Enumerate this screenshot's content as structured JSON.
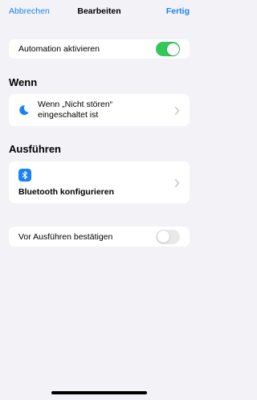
{
  "nav": {
    "cancel_label": "Abbrechen",
    "title": "Bearbeiten",
    "done_label": "Fertig"
  },
  "automation_toggle": {
    "label": "Automation aktivieren",
    "enabled": true,
    "on_color": "#34c759"
  },
  "when": {
    "section_title": "Wenn",
    "trigger_line1": "Wenn „Nicht stören“",
    "trigger_line2": "eingeschaltet ist",
    "icon": "moon-icon"
  },
  "run": {
    "section_title": "Ausführen",
    "action_label": "Bluetooth konfigurieren",
    "icon": "bluetooth-icon",
    "icon_color": "#1a82f7"
  },
  "confirm_toggle": {
    "label": "Vor Ausführen bestätigen",
    "enabled": false,
    "off_color": "#e9e9ea"
  },
  "colors": {
    "accent": "#1a82f7",
    "background": "#f2f2f7"
  }
}
